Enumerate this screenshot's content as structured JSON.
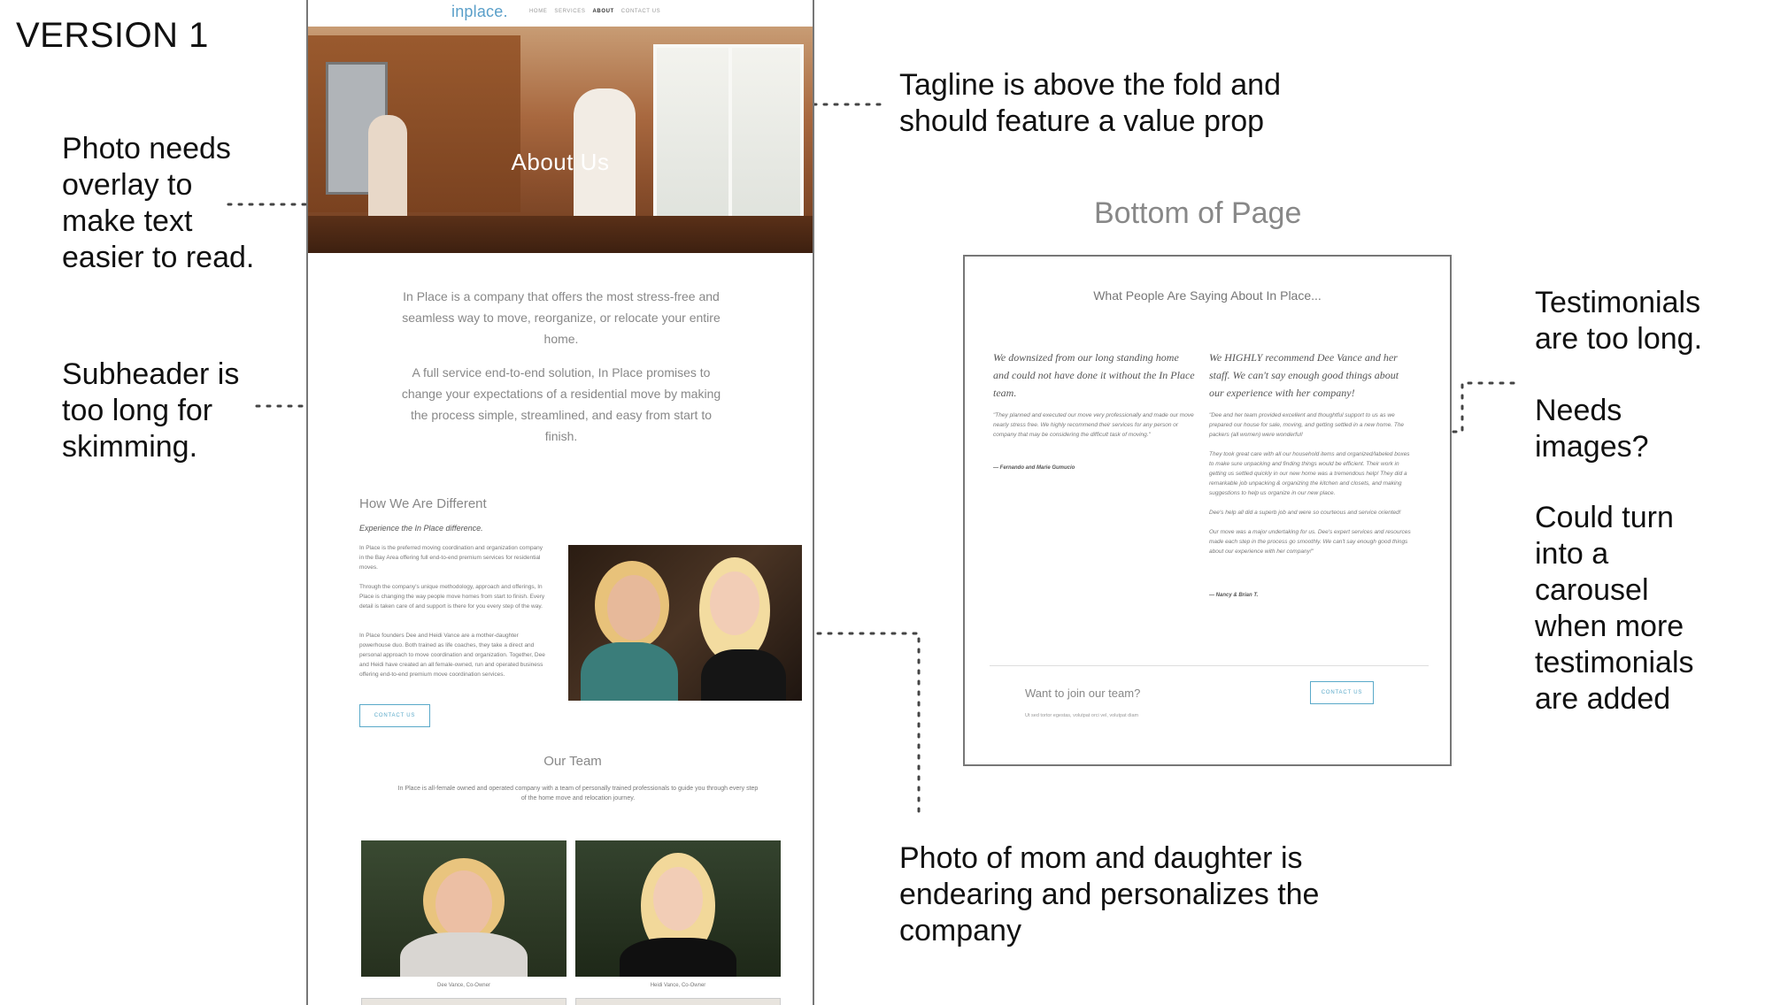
{
  "page": {
    "version_label": "VERSION 1",
    "bottom_heading": "Bottom of Page"
  },
  "annotations": {
    "photo_overlay": "Photo needs\noverlay to\nmake text\neasier to read.",
    "subheader": "Subheader is\ntoo long for\nskimming.",
    "tagline": "Tagline is above the fold and\nshould feature a value prop",
    "testimonials_long": "Testimonials\nare too long.",
    "needs_images": "Needs\nimages?",
    "carousel": "Could turn\ninto a\ncarousel\nwhen more\ntestimonials\nare added",
    "mom_daughter": "Photo of mom and daughter is\nendearing and personalizes the\ncompany"
  },
  "site": {
    "logo": "inplace.",
    "nav": [
      "HOME",
      "SERVICES",
      "ABOUT",
      "CONTACT US"
    ],
    "nav_active": "ABOUT",
    "hero_title": "About Us",
    "intro_p1": "In Place is a company that offers the most stress-free and seamless way to move, reorganize, or relocate your entire home.",
    "intro_p2": "A full service end-to-end solution, In Place promises to change your expectations of a residential move by making the process simple, streamlined, and easy from start to finish.",
    "how_title": "How We Are Different",
    "how_subtitle": "Experience the In Place difference.",
    "how_p1": "In Place is the preferred moving coordination and organization company in the Bay Area offering full end-to-end premium services for residential moves.",
    "how_p2": "Through the company's unique methodology, approach and offerings, In Place is changing the way people move homes from start to finish. Every detail is taken care of and support is there for you every step of the way.",
    "how_p3": "In Place founders Dee and Heidi Vance are a mother-daughter powerhouse duo. Both trained as life coaches, they take a direct and personal approach to move coordination and organization. Together, Dee and Heidi have created an all female-owned, run and operated business offering end-to-end premium move coordination services.",
    "contact_btn": "CONTACT US",
    "team_title": "Our Team",
    "team_desc": "In Place is all-female owned and operated company with a team of personally trained professionals to guide you through every step of the home move and relocation journey.",
    "team_members": [
      {
        "caption": "Dee Vance, Co-Owner"
      },
      {
        "caption": "Heidi Vance, Co-Owner"
      }
    ]
  },
  "bottom": {
    "testimonials_title": "What People Are Saying About In Place...",
    "testimonials": [
      {
        "quote": "We downsized from our long standing home and could not have done it without the In Place team.",
        "body": "\"They planned and executed our move very professionally and made our move nearly stress free. We highly recommend their services for any person or company that may be considering the difficult task of moving.\"",
        "author": "— Fernando and Marie Gumucio"
      },
      {
        "quote": "We HIGHLY recommend Dee Vance and her staff. We can't say enough good things about our experience with her company!",
        "body": "\"Dee and her team provided excellent and thoughtful support to us as we prepared our house for sale, moving, and getting settled in a new home. The packers (all women) were wonderful!\n\nThey took great care with all our household items and organized/labeled boxes to make sure unpacking and finding things would be efficient. Their work in getting us settled quickly in our new home was a tremendous help! They did a remarkable job unpacking & organizing the kitchen and closets, and making suggestions to help us organize in our new place.\n\nDee's help all did a superb job and were so courteous and service oriented!\n\nOur move was a major undertaking for us. Dee's expert services and resources made each step in the process go smoothly. We can't say enough good things about our experience with her company!\"",
        "author": "— Nancy & Brian T."
      }
    ],
    "join_title": "Want to join our team?",
    "join_sub": "Ut sed tortor egestas, volutpat orci vel, volutpat diam",
    "join_btn": "CONTACT US"
  }
}
